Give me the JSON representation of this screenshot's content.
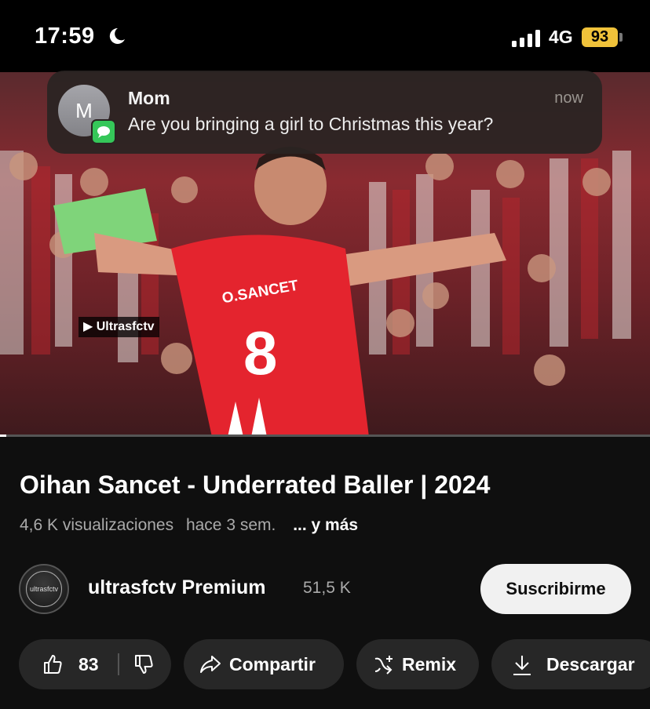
{
  "status_bar": {
    "time": "17:59",
    "network": "4G",
    "battery": "93"
  },
  "notification": {
    "avatar_letter": "M",
    "sender": "Mom",
    "time": "now",
    "message": "Are you bringing a girl to Christmas this year?"
  },
  "video": {
    "watermark": "Ultrasfctv",
    "jersey_name": "O.SANCET",
    "jersey_number": "8",
    "progress": 0.01
  },
  "info": {
    "title": "Oihan Sancet - Underrated Baller | 2024",
    "views": "4,6 K visualizaciones",
    "age": "hace 3 sem.",
    "more": "... y más"
  },
  "channel": {
    "avatar_text": "ultrasfctv",
    "name": "ultrasfctv Premium",
    "subscribers": "51,5 K",
    "subscribe_label": "Suscribirme"
  },
  "actions": {
    "likes": "83",
    "share": "Compartir",
    "remix": "Remix",
    "download": "Descargar"
  }
}
